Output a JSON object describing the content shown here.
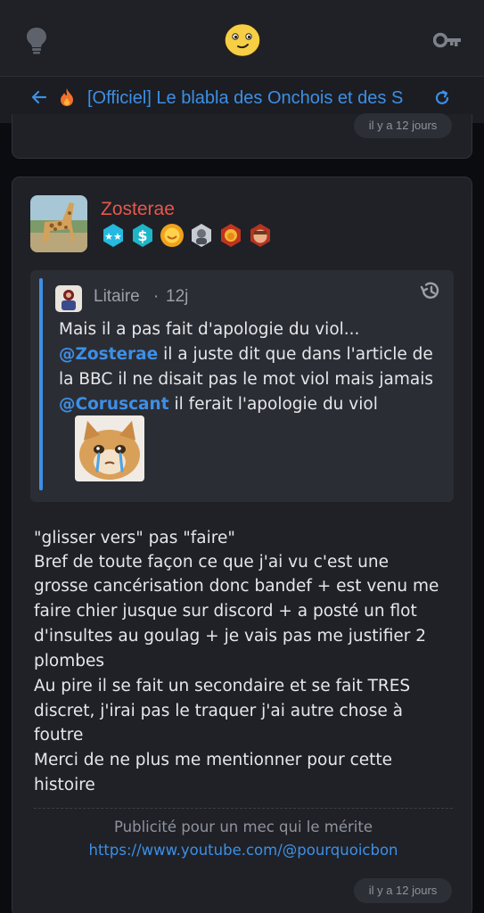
{
  "header": {
    "icons": [
      "lightbulb-icon",
      "smiley-logo-icon",
      "key-icon"
    ]
  },
  "topic": {
    "title": "[Officiel] Le blabla des Onchois et des S",
    "icons": [
      "back-arrow-icon",
      "flame-icon",
      "refresh-icon"
    ]
  },
  "previous_post": {
    "time": "il y a 12 jours"
  },
  "post": {
    "author": "Zosterae",
    "badges": [
      "stars-badge",
      "dollar-badge",
      "smile-badge",
      "portrait-badge",
      "lion-badge",
      "face-badge"
    ],
    "quote": {
      "author": "Litaire",
      "separator": "·",
      "time": "12j",
      "line1": "Mais il a pas fait d'apologie du viol...",
      "line2_mention": "@Zosterae",
      "line2_text": " il a juste dit que dans l'article de",
      "line3": "la BBC il ne disait pas le mot viol mais jamais",
      "line4_mention": "@Coruscant",
      "line4_text": " il ferait l'apologie du viol"
    },
    "body_lines": [
      "\"glisser vers\" pas \"faire\"",
      "Bref de toute façon ce que j'ai vu c'est une",
      "grosse cancérisation donc bandef + est venu me",
      "faire chier jusque sur discord + a posté un flot",
      "d'insultes au goulag + je vais pas me justifier 2",
      "plombes",
      "Au pire il se fait un secondaire et se fait TRES",
      "discret, j'irai pas le traquer j'ai autre chose à",
      "foutre",
      "Merci de ne plus me mentionner pour cette",
      "histoire"
    ],
    "signature": {
      "text": "Publicité pour un mec qui le mérite",
      "link": "https://www.youtube.com/@pourquoicbon"
    },
    "time": "il y a 12 jours"
  },
  "colors": {
    "accent": "#3d8fe6",
    "author": "#e8574a",
    "background": "#0b0c0f",
    "card": "#1f2127"
  }
}
